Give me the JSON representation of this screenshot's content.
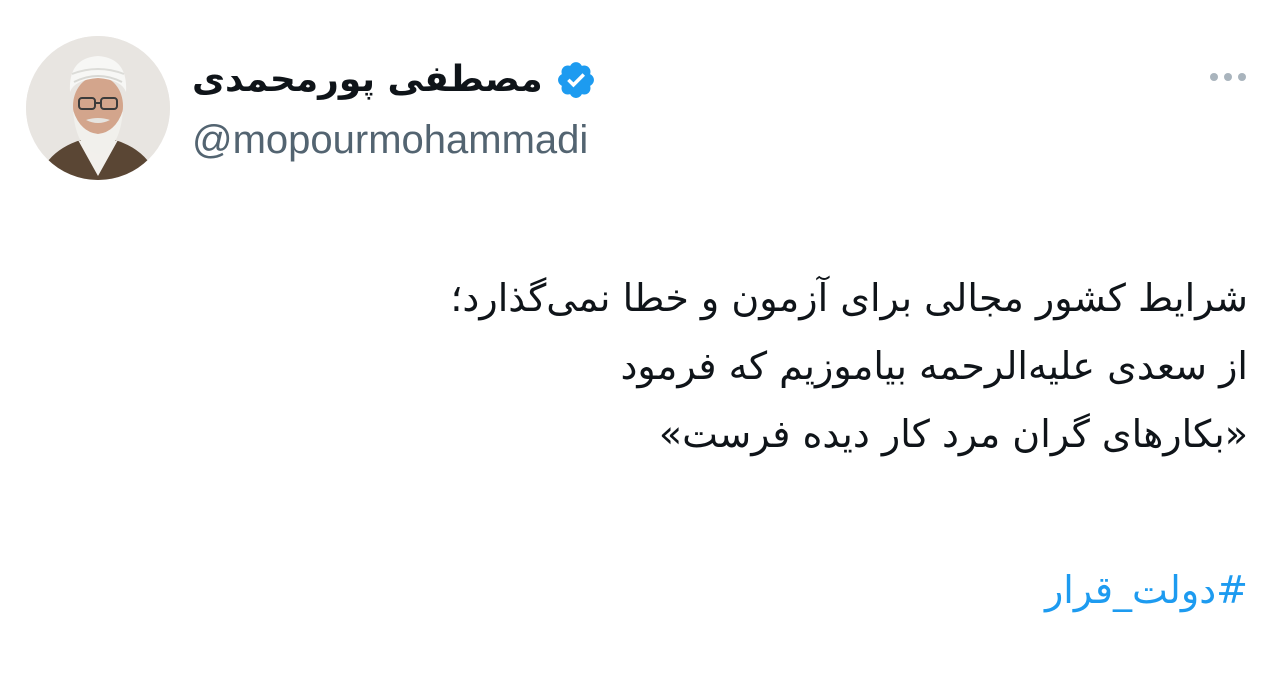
{
  "author": {
    "display_name": "مصطفی پورمحمدی",
    "handle": "@mopourmohammadi",
    "verified": true
  },
  "icons": {
    "verified": "verified-badge-icon",
    "more": "more-options-icon"
  },
  "tweet": {
    "lines": [
      "شرایط کشور مجالی برای آزمون و خطا نمی‌گذارد؛",
      "از سعدی علیه‌الرحمه بیاموزیم که فرمود",
      "«بکارهای گران مرد کار دیده فرست»"
    ],
    "hashtag": "#دولت_قرار"
  },
  "colors": {
    "link": "#1d9bf0",
    "verified": "#1d9bf0",
    "secondary_text": "#536471",
    "primary_text": "#0f1419",
    "background": "#ffffff"
  }
}
